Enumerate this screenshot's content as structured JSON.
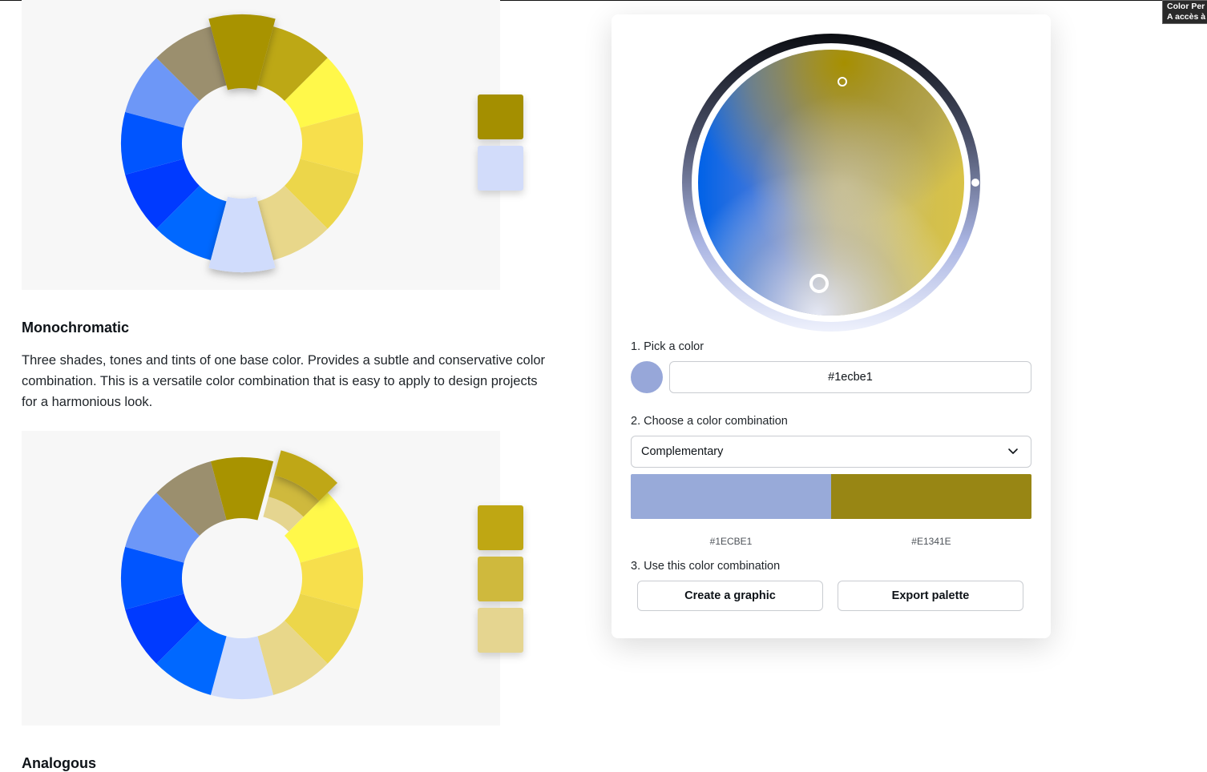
{
  "tooltip": {
    "line1": "Color Per",
    "line2": "A accès à"
  },
  "panels": {
    "complementary": {
      "swatches": [
        "#a48f00",
        "#d2dcfa"
      ]
    },
    "monochromatic": {
      "title": "Monochromatic",
      "description": "Three shades, tones and tints of one base color. Provides a subtle and conservative color combination. This is a versatile color combination that is easy to apply to design projects for a harmonious look.",
      "swatches": [
        "#bfa713",
        "#cfb93d",
        "#e5d590"
      ]
    },
    "next_section_title": "Analogous"
  },
  "wheel_colors": [
    "#a89300",
    "#bda815",
    "#fff84a",
    "#f7df4c",
    "#ecd64a",
    "#e8d78a",
    "#d0dcfc",
    "#0068ff",
    "#003aff",
    "#0055ff",
    "#6d97f7",
    "#9b8f6e"
  ],
  "generator": {
    "step1_label": "1. Pick a color",
    "hex_value": "#1ecbe1",
    "preview_color": "#97a7d9",
    "step2_label": "2. Choose a color combination",
    "combination": "Complementary",
    "combo_colors": [
      "#98aad9",
      "#988614"
    ],
    "combo_hex": [
      "#1ECBE1",
      "#E1341E"
    ],
    "step3_label": "3. Use this color combination",
    "create_label": "Create a graphic",
    "export_label": "Export palette"
  }
}
